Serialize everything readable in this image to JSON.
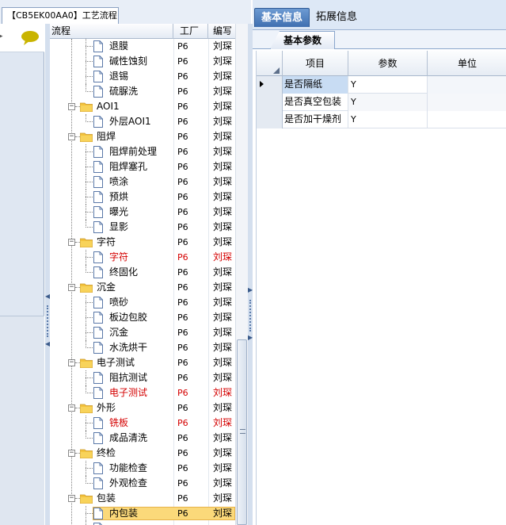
{
  "top_tab": {
    "label": "【CB5EK00AA0】工艺流程"
  },
  "tree": {
    "headers": {
      "flow": "流程",
      "factory": "工厂",
      "author": "编写"
    },
    "rows": [
      {
        "type": "item",
        "label": "退膜",
        "factory": "P6",
        "author": "刘琛",
        "red": false,
        "last": false
      },
      {
        "type": "item",
        "label": "碱性蚀刻",
        "factory": "P6",
        "author": "刘琛",
        "red": false,
        "last": false
      },
      {
        "type": "item",
        "label": "退锡",
        "factory": "P6",
        "author": "刘琛",
        "red": false,
        "last": false
      },
      {
        "type": "item",
        "label": "硫脲洗",
        "factory": "P6",
        "author": "刘琛",
        "red": false,
        "last": true
      },
      {
        "type": "group",
        "label": "AOI1",
        "factory": "P6",
        "author": "刘琛",
        "red": false
      },
      {
        "type": "item",
        "label": "外层AOI1",
        "factory": "P6",
        "author": "刘琛",
        "red": false,
        "last": true
      },
      {
        "type": "group",
        "label": "阻焊",
        "factory": "P6",
        "author": "刘琛",
        "red": false
      },
      {
        "type": "item",
        "label": "阻焊前处理",
        "factory": "P6",
        "author": "刘琛",
        "red": false,
        "last": false
      },
      {
        "type": "item",
        "label": "阻焊塞孔",
        "factory": "P6",
        "author": "刘琛",
        "red": false,
        "last": false
      },
      {
        "type": "item",
        "label": "喷涂",
        "factory": "P6",
        "author": "刘琛",
        "red": false,
        "last": false
      },
      {
        "type": "item",
        "label": "预烘",
        "factory": "P6",
        "author": "刘琛",
        "red": false,
        "last": false
      },
      {
        "type": "item",
        "label": "曝光",
        "factory": "P6",
        "author": "刘琛",
        "red": false,
        "last": false
      },
      {
        "type": "item",
        "label": "显影",
        "factory": "P6",
        "author": "刘琛",
        "red": false,
        "last": true
      },
      {
        "type": "group",
        "label": "字符",
        "factory": "P6",
        "author": "刘琛",
        "red": false
      },
      {
        "type": "item",
        "label": "字符",
        "factory": "P6",
        "author": "刘琛",
        "red": true,
        "last": false
      },
      {
        "type": "item",
        "label": "终固化",
        "factory": "P6",
        "author": "刘琛",
        "red": false,
        "last": true
      },
      {
        "type": "group",
        "label": "沉金",
        "factory": "P6",
        "author": "刘琛",
        "red": false
      },
      {
        "type": "item",
        "label": "喷砂",
        "factory": "P6",
        "author": "刘琛",
        "red": false,
        "last": false
      },
      {
        "type": "item",
        "label": "板边包胶",
        "factory": "P6",
        "author": "刘琛",
        "red": false,
        "last": false
      },
      {
        "type": "item",
        "label": "沉金",
        "factory": "P6",
        "author": "刘琛",
        "red": false,
        "last": false
      },
      {
        "type": "item",
        "label": "水洗烘干",
        "factory": "P6",
        "author": "刘琛",
        "red": false,
        "last": true
      },
      {
        "type": "group",
        "label": "电子测试",
        "factory": "P6",
        "author": "刘琛",
        "red": false
      },
      {
        "type": "item",
        "label": "阻抗测试",
        "factory": "P6",
        "author": "刘琛",
        "red": false,
        "last": false
      },
      {
        "type": "item",
        "label": "电子测试",
        "factory": "P6",
        "author": "刘琛",
        "red": true,
        "last": true
      },
      {
        "type": "group",
        "label": "外形",
        "factory": "P6",
        "author": "刘琛",
        "red": false
      },
      {
        "type": "item",
        "label": "铣板",
        "factory": "P6",
        "author": "刘琛",
        "red": true,
        "last": false
      },
      {
        "type": "item",
        "label": "成品清洗",
        "factory": "P6",
        "author": "刘琛",
        "red": false,
        "last": true
      },
      {
        "type": "group",
        "label": "终检",
        "factory": "P6",
        "author": "刘琛",
        "red": false
      },
      {
        "type": "item",
        "label": "功能检查",
        "factory": "P6",
        "author": "刘琛",
        "red": false,
        "last": false
      },
      {
        "type": "item",
        "label": "外观检查",
        "factory": "P6",
        "author": "刘琛",
        "red": false,
        "last": true
      },
      {
        "type": "group",
        "label": "包装",
        "factory": "P6",
        "author": "刘琛",
        "red": false
      },
      {
        "type": "item",
        "label": "内包装",
        "factory": "P6",
        "author": "刘琛",
        "red": false,
        "last": false,
        "selected": true
      },
      {
        "type": "item",
        "label": "",
        "factory": "",
        "author": "",
        "red": false,
        "last": false
      }
    ]
  },
  "right_tabs": [
    {
      "label": "基本信息",
      "active": true
    },
    {
      "label": "拓展信息",
      "active": false
    }
  ],
  "sub_tab": {
    "label": "基本参数"
  },
  "param_grid": {
    "headers": {
      "item": "项目",
      "param": "参数",
      "unit": "单位"
    },
    "rows": [
      {
        "item": "是否隔纸",
        "param": "Y",
        "unit": "",
        "current": true
      },
      {
        "item": "是否真空包装",
        "param": "Y",
        "unit": "",
        "current": false
      },
      {
        "item": "是否加干燥剂",
        "param": "Y",
        "unit": "",
        "current": false
      }
    ]
  },
  "icons": {
    "chat": "speech-bubble-icon",
    "folder": "folder-icon",
    "file": "document-icon",
    "expander": "collapse-minus-icon"
  },
  "colors": {
    "chat_icon": "#c9b400",
    "folder": "#f3c33d",
    "active_tab": "#3f6fb0",
    "selected_row": "#fbd97a",
    "red_text": "#d40000",
    "current_cell": "#c8dcf3"
  }
}
